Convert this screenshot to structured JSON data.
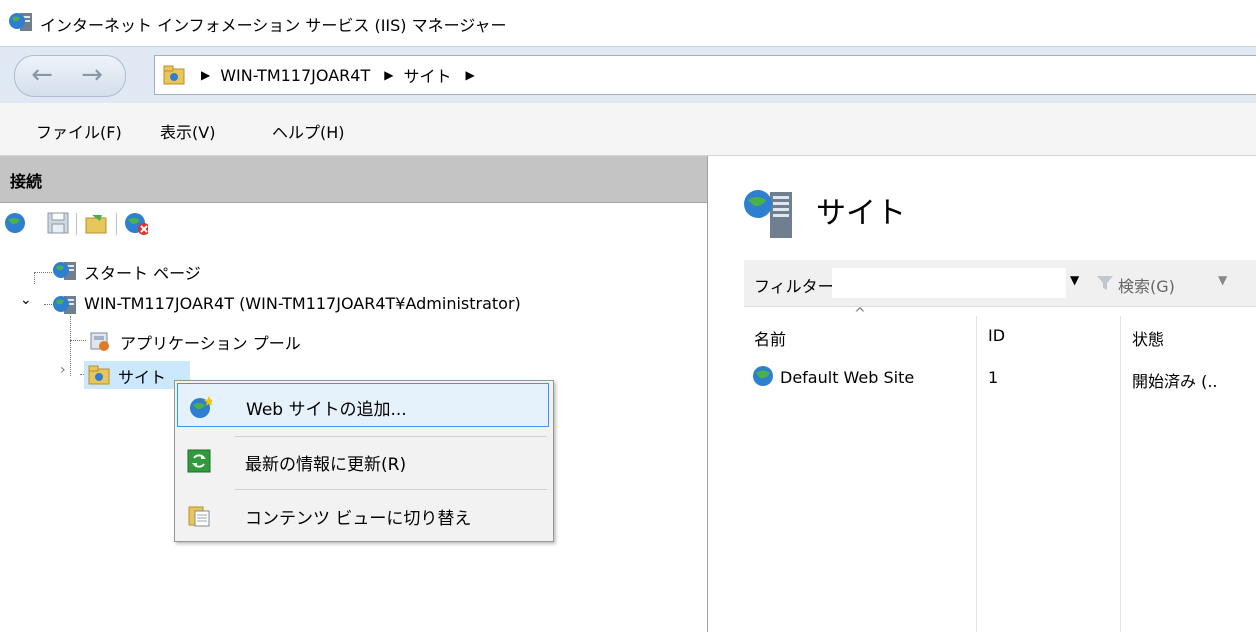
{
  "window": {
    "title": "インターネット インフォメーション サービス (IIS) マネージャー"
  },
  "address": {
    "crumbs": [
      "WIN-TM117JOAR4T",
      "サイト"
    ]
  },
  "menu": {
    "file": "ファイル(F)",
    "view": "表示(V)",
    "help": "ヘルプ(H)"
  },
  "connections": {
    "header": "接続",
    "tree": {
      "start_page": "スタート ページ",
      "server": "WIN-TM117JOAR4T (WIN-TM117JOAR4T¥Administrator)",
      "app_pools": "アプリケーション プール",
      "sites": "サイト"
    }
  },
  "context_menu": {
    "items": [
      "Web サイトの追加...",
      "最新の情報に更新(R)",
      "コンテンツ ビューに切り替え"
    ]
  },
  "sites_panel": {
    "title": "サイト",
    "filter_label": "フィルター:",
    "search_label": "検索(G)",
    "columns": [
      "名前",
      "ID",
      "状態"
    ],
    "rows": [
      {
        "name": "Default Web Site",
        "id": "1",
        "state": "開始済み (.."
      }
    ]
  },
  "colors": {
    "selection": "#cce8ff",
    "menu_highlight": "#e5f1fb",
    "header_gray": "#c4c4c4",
    "address_bar": "#dfe8f3"
  },
  "icons": [
    "iis-globe-server-icon",
    "folder-icon",
    "globe-icon",
    "save-icon",
    "connect-icon",
    "disconnect-icon",
    "app-pool-icon",
    "refresh-icon",
    "content-view-icon",
    "filter-funnel-icon"
  ]
}
